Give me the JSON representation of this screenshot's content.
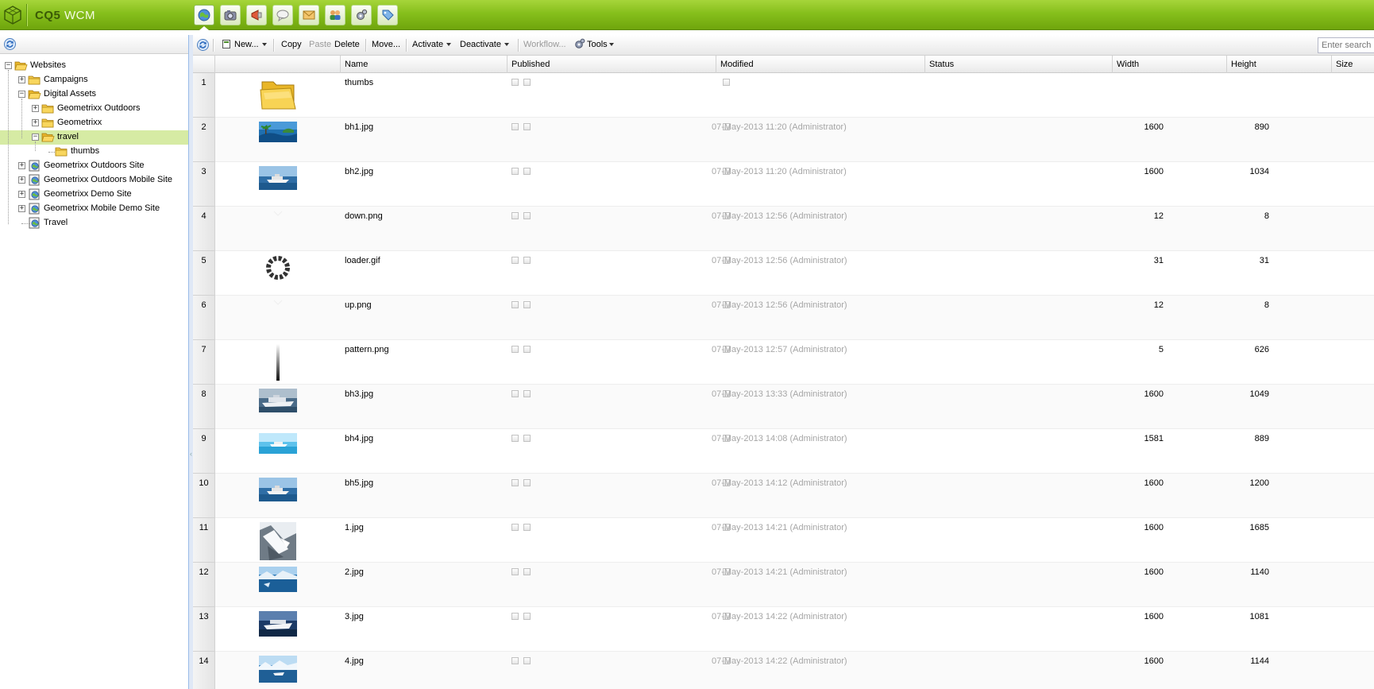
{
  "app": {
    "title_bold": "CQ5",
    "title_light": "WCM"
  },
  "console_buttons": [
    {
      "name": "websites-console-icon",
      "active": true
    },
    {
      "name": "digital-assets-console-icon",
      "active": false
    },
    {
      "name": "campaigns-console-icon",
      "active": false
    },
    {
      "name": "community-console-icon",
      "active": false
    },
    {
      "name": "inbox-console-icon",
      "active": false
    },
    {
      "name": "users-console-icon",
      "active": false
    },
    {
      "name": "tools-console-icon",
      "active": false
    },
    {
      "name": "tagging-console-icon",
      "active": false
    }
  ],
  "tree": {
    "nodes": [
      {
        "label": "Websites",
        "level": 0,
        "toggle": "−",
        "icon": "folder-open-icon",
        "selected": false
      },
      {
        "label": "Campaigns",
        "level": 1,
        "toggle": "+",
        "icon": "folder-icon",
        "selected": false
      },
      {
        "label": "Digital Assets",
        "level": 1,
        "toggle": "−",
        "icon": "folder-open-icon",
        "selected": false
      },
      {
        "label": "Geometrixx Outdoors",
        "level": 2,
        "toggle": "+",
        "icon": "folder-icon",
        "selected": false
      },
      {
        "label": "Geometrixx",
        "level": 2,
        "toggle": "+",
        "icon": "folder-icon",
        "selected": false
      },
      {
        "label": "travel",
        "level": 2,
        "toggle": "−",
        "icon": "folder-open-icon",
        "selected": true
      },
      {
        "label": "thumbs",
        "level": 3,
        "toggle": "",
        "icon": "folder-icon",
        "selected": false
      },
      {
        "label": "Geometrixx Outdoors Site",
        "level": 1,
        "toggle": "+",
        "icon": "site-icon",
        "selected": false
      },
      {
        "label": "Geometrixx Outdoors Mobile Site",
        "level": 1,
        "toggle": "+",
        "icon": "site-icon",
        "selected": false
      },
      {
        "label": "Geometrixx Demo Site",
        "level": 1,
        "toggle": "+",
        "icon": "site-icon",
        "selected": false
      },
      {
        "label": "Geometrixx Mobile Demo Site",
        "level": 1,
        "toggle": "+",
        "icon": "site-icon",
        "selected": false
      },
      {
        "label": "Travel",
        "level": 1,
        "toggle": "",
        "icon": "site-icon",
        "selected": false
      }
    ]
  },
  "toolbar": {
    "new_label": "New...",
    "copy_label": "Copy",
    "paste_label": "Paste",
    "delete_label": "Delete",
    "move_label": "Move...",
    "activate_label": "Activate",
    "deactivate_label": "Deactivate",
    "workflow_label": "Workflow...",
    "tools_label": "Tools",
    "search_placeholder": "Enter search"
  },
  "columns": {
    "name": "Name",
    "published": "Published",
    "modified": "Modified",
    "status": "Status",
    "width": "Width",
    "height": "Height",
    "size": "Size"
  },
  "rows": [
    {
      "num": "1",
      "name": "thumbs",
      "thumb": "folder",
      "modified": "",
      "width": "",
      "height": ""
    },
    {
      "num": "2",
      "name": "bh1.jpg",
      "thumb": "island",
      "modified": "07-May-2013 11:20 (Administrator)",
      "width": "1600",
      "height": "890"
    },
    {
      "num": "3",
      "name": "bh2.jpg",
      "thumb": "ship-sea",
      "modified": "07-May-2013 11:20 (Administrator)",
      "width": "1600",
      "height": "1034"
    },
    {
      "num": "4",
      "name": "down.png",
      "thumb": "blank",
      "modified": "07-May-2013 12:56 (Administrator)",
      "width": "12",
      "height": "8"
    },
    {
      "num": "5",
      "name": "loader.gif",
      "thumb": "loader",
      "modified": "07-May-2013 12:56 (Administrator)",
      "width": "31",
      "height": "31"
    },
    {
      "num": "6",
      "name": "up.png",
      "thumb": "blank",
      "modified": "07-May-2013 12:56 (Administrator)",
      "width": "12",
      "height": "8"
    },
    {
      "num": "7",
      "name": "pattern.png",
      "thumb": "pattern",
      "modified": "07-May-2013 12:57 (Administrator)",
      "width": "5",
      "height": "626"
    },
    {
      "num": "8",
      "name": "bh3.jpg",
      "thumb": "ship-grey",
      "modified": "07-May-2013 13:33 (Administrator)",
      "width": "1600",
      "height": "1049"
    },
    {
      "num": "9",
      "name": "bh4.jpg",
      "thumb": "ship-light",
      "modified": "07-May-2013 14:08 (Administrator)",
      "width": "1581",
      "height": "889"
    },
    {
      "num": "10",
      "name": "bh5.jpg",
      "thumb": "ship-sea",
      "modified": "07-May-2013 14:12 (Administrator)",
      "width": "1600",
      "height": "1200"
    },
    {
      "num": "11",
      "name": "1.jpg",
      "thumb": "mountain",
      "modified": "07-May-2013 14:21 (Administrator)",
      "width": "1600",
      "height": "1685"
    },
    {
      "num": "12",
      "name": "2.jpg",
      "thumb": "fjord",
      "modified": "07-May-2013 14:21 (Administrator)",
      "width": "1600",
      "height": "1140"
    },
    {
      "num": "13",
      "name": "3.jpg",
      "thumb": "ship-night",
      "modified": "07-May-2013 14:22 (Administrator)",
      "width": "1600",
      "height": "1081"
    },
    {
      "num": "14",
      "name": "4.jpg",
      "thumb": "glacier",
      "modified": "07-May-2013 14:22 (Administrator)",
      "width": "1600",
      "height": "1144"
    }
  ],
  "colors": {
    "header_green": "#86bf1c",
    "selection_green": "#d6eba4",
    "muted_text": "#a6a6a6"
  }
}
